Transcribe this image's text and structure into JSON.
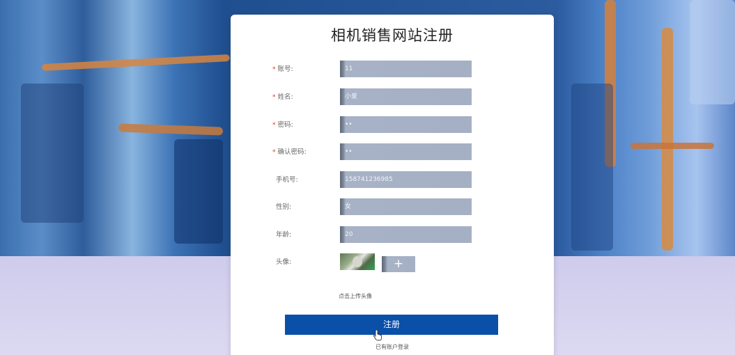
{
  "page": {
    "title": "相机销售网站注册"
  },
  "form": {
    "fields": [
      {
        "label": "账号:",
        "required": true,
        "value": "11"
      },
      {
        "label": "姓名:",
        "required": true,
        "value": "小爱"
      },
      {
        "label": "密码:",
        "required": true,
        "value": "••"
      },
      {
        "label": "确认密码:",
        "required": true,
        "value": "••"
      },
      {
        "label": "手机号:",
        "required": false,
        "value": "158741236985"
      },
      {
        "label": "性别:",
        "required": false,
        "value": "女"
      },
      {
        "label": "年龄:",
        "required": false,
        "value": "20"
      }
    ],
    "avatar_label": "头像:",
    "upload_icon": "+",
    "upload_hint": "点击上传头像",
    "required_mark": "*"
  },
  "actions": {
    "register_label": "注册",
    "login_link": "已有账户登录"
  },
  "colors": {
    "primary_button": "#0a4fa8",
    "required_star": "#d93025",
    "card_bg": "#ffffff"
  }
}
